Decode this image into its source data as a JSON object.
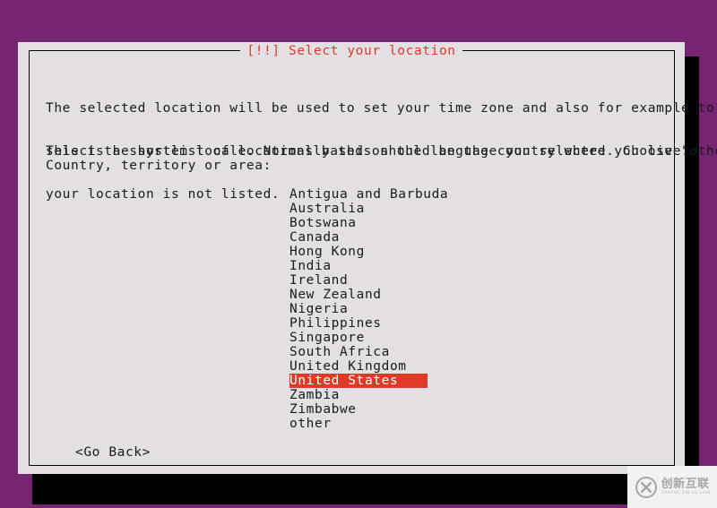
{
  "screen": {
    "background_color": "#762572",
    "dialog_background_color": "#e4dfe3",
    "accent_color": "#e03a26",
    "text_color": "#1b1b1b"
  },
  "dialog": {
    "title": "[!!] Select your location",
    "intro_paragraph": {
      "line1": "The selected location will be used to set your time zone and also for example to help",
      "line2": "select the system locale. Normally this should be the country where you live."
    },
    "shortlist_paragraph": {
      "line1": "This is a shortlist of locations based on the language you selected. Choose \"other\" if",
      "line2": "your location is not listed."
    },
    "prompt_label": "Country, territory or area:",
    "country_list": [
      {
        "label": "Antigua and Barbuda",
        "selected": false
      },
      {
        "label": "Australia",
        "selected": false
      },
      {
        "label": "Botswana",
        "selected": false
      },
      {
        "label": "Canada",
        "selected": false
      },
      {
        "label": "Hong Kong",
        "selected": false
      },
      {
        "label": "India",
        "selected": false
      },
      {
        "label": "Ireland",
        "selected": false
      },
      {
        "label": "New Zealand",
        "selected": false
      },
      {
        "label": "Nigeria",
        "selected": false
      },
      {
        "label": "Philippines",
        "selected": false
      },
      {
        "label": "Singapore",
        "selected": false
      },
      {
        "label": "South Africa",
        "selected": false
      },
      {
        "label": "United Kingdom",
        "selected": false
      },
      {
        "label": "United States",
        "selected": true
      },
      {
        "label": "Zambia",
        "selected": false
      },
      {
        "label": "Zimbabwe",
        "selected": false
      },
      {
        "label": "other",
        "selected": false
      }
    ],
    "selected_country": "United States",
    "go_back_button": "<Go Back>"
  },
  "watermark": {
    "icon": "circled-x-logo",
    "chinese_text": "创新互联",
    "pinyin_text": "CHUANG XIN HU LIAN"
  }
}
